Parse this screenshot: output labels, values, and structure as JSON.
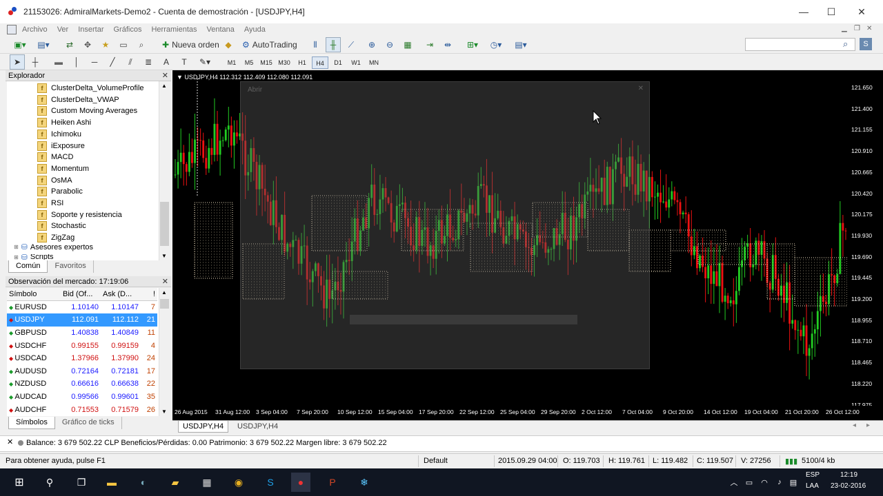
{
  "window": {
    "title": "21153026: AdmiralMarkets-Demo2 - Cuenta de demostración - [USDJPY,H4]",
    "minimize": "—",
    "maximize": "☐",
    "close": "✕"
  },
  "menu": [
    "Archivo",
    "Ver",
    "Insertar",
    "Gráficos",
    "Herramientas",
    "Ventana",
    "Ayuda"
  ],
  "toolbar": {
    "new_order": "Nueva orden",
    "autotrading": "AutoTrading"
  },
  "timeframes": [
    "M1",
    "M5",
    "M15",
    "M30",
    "H1",
    "H4",
    "D1",
    "W1",
    "MN"
  ],
  "selected_timeframe": "H4",
  "explorer": {
    "title": "Explorador",
    "items": [
      "ClusterDelta_VolumeProfile",
      "ClusterDelta_VWAP",
      "Custom Moving Averages",
      "Heiken Ashi",
      "Ichimoku",
      "iExposure",
      "MACD",
      "Momentum",
      "OsMA",
      "Parabolic",
      "RSI",
      "Soporte y resistencia",
      "Stochastic",
      "ZigZag"
    ],
    "folder1": "Asesores expertos",
    "folder2": "Scripts",
    "tab_common": "Común",
    "tab_favorites": "Favoritos"
  },
  "market_watch": {
    "title": "Observación del mercado: 17:19:06",
    "headers": [
      "Símbolo",
      "Bid (Of...",
      "Ask (D...",
      "!"
    ],
    "rows": [
      {
        "symbol": "EURUSD",
        "bid": "1.10140",
        "ask": "1.10147",
        "spread": "7",
        "dir": "up"
      },
      {
        "symbol": "USDJPY",
        "bid": "112.091",
        "ask": "112.112",
        "spread": "21",
        "dir": "down"
      },
      {
        "symbol": "GBPUSD",
        "bid": "1.40838",
        "ask": "1.40849",
        "spread": "11",
        "dir": "up"
      },
      {
        "symbol": "USDCHF",
        "bid": "0.99155",
        "ask": "0.99159",
        "spread": "4",
        "dir": "down"
      },
      {
        "symbol": "USDCAD",
        "bid": "1.37966",
        "ask": "1.37990",
        "spread": "24",
        "dir": "down"
      },
      {
        "symbol": "AUDUSD",
        "bid": "0.72164",
        "ask": "0.72181",
        "spread": "17",
        "dir": "up"
      },
      {
        "symbol": "NZDUSD",
        "bid": "0.66616",
        "ask": "0.66638",
        "spread": "22",
        "dir": "up"
      },
      {
        "symbol": "AUDCAD",
        "bid": "0.99566",
        "ask": "0.99601",
        "spread": "35",
        "dir": "up"
      },
      {
        "symbol": "AUDCHF",
        "bid": "0.71553",
        "ask": "0.71579",
        "spread": "26",
        "dir": "down"
      }
    ],
    "tab_symbols": "Símbolos",
    "tab_ticks": "Gráfico de ticks"
  },
  "chart": {
    "header": "USDJPY,H4  112.312 112.409 112.080 112.091",
    "overlay_title": "Abrir",
    "price_labels": [
      "121.650",
      "121.400",
      "121.155",
      "120.910",
      "120.665",
      "120.420",
      "120.175",
      "119.930",
      "119.690",
      "119.445",
      "119.200",
      "118.955",
      "118.710",
      "118.465",
      "118.220",
      "117.975"
    ],
    "time_labels": [
      "26 Aug 2015",
      "31 Aug 12:00",
      "3 Sep 04:00",
      "7 Sep 20:00",
      "10 Sep 12:00",
      "15 Sep 04:00",
      "17 Sep 20:00",
      "22 Sep 12:00",
      "25 Sep 04:00",
      "29 Sep 20:00",
      "2 Oct 12:00",
      "7 Oct 04:00",
      "9 Oct 20:00",
      "14 Oct 12:00",
      "19 Oct 04:00",
      "21 Oct 20:00",
      "26 Oct 12:00"
    ],
    "tabs": [
      "USDJPY,H4",
      "USDJPY,H4"
    ],
    "colors": {
      "bull": "#22cc22",
      "bear": "#ee1111",
      "cloud": "#f0e0c0"
    }
  },
  "terminal": {
    "balance_line": "Balance: 3 679 502.22 CLP  Beneficios/Pérdidas: 0.00  Patrimonio: 3 679 502.22  Margen libre: 3 679 502.22"
  },
  "status": {
    "help": "Para obtener ayuda, pulse F1",
    "profile": "Default",
    "datetime": "2015.09.29 04:00",
    "open": "O: 119.703",
    "high": "H: 119.761",
    "low": "L: 119.482",
    "close": "C: 119.507",
    "volume": "V: 27256",
    "traffic": "5100/4 kb"
  },
  "taskbar": {
    "lang": "ESP",
    "lang2": "LAA",
    "time": "12:19",
    "date": "23-02-2016"
  }
}
